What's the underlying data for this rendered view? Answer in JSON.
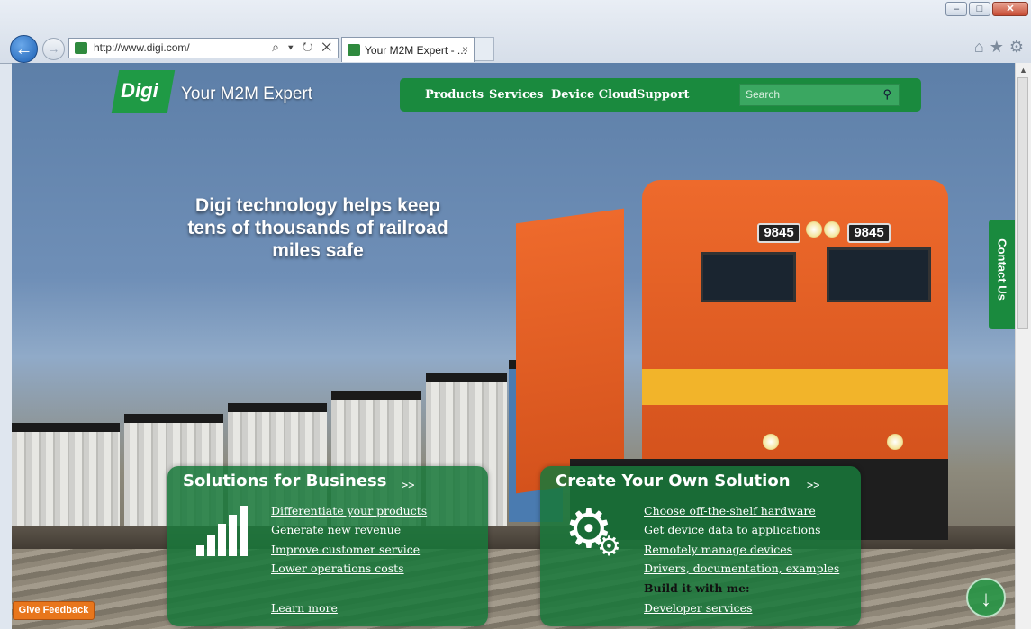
{
  "browser": {
    "address_url": "http://www.digi.com/",
    "address_actions": "⌕ ▾ ↻ ✕",
    "tab_title": "Your M2M Expert - ...",
    "tab_close": "×",
    "back_glyph": "←",
    "forward_glyph": "→",
    "window_buttons": {
      "minimize": "–",
      "maximize": "□",
      "close": "✕"
    },
    "toolbar_icons": {
      "home": "⌂",
      "favorites": "★",
      "tools": "⚙"
    }
  },
  "site": {
    "logo_text": "Digi",
    "tagline": "Your M2M Expert",
    "nav": [
      "Products",
      "Services",
      "Device Cloud",
      "Support"
    ],
    "search_placeholder": "Search",
    "search_icon": "⚲",
    "headline": "Digi technology helps keep tens of thousands of railroad miles safe",
    "contact_tab": "Contact Us",
    "locomotive_number": "9845",
    "give_feedback": "Give Feedback",
    "scroll_down_glyph": "↓"
  },
  "cards": {
    "business": {
      "title": "Solutions for Business",
      "arrow": ">>",
      "links": [
        "Differentiate your products",
        "Generate new revenue",
        "Improve customer service",
        "Lower operations costs"
      ],
      "learn_more": "Learn more"
    },
    "own": {
      "title": "Create Your Own Solution",
      "arrow": ">>",
      "links": [
        "Choose off-the-shelf hardware",
        "Get device data to applications",
        "Remotely manage devices",
        "Drivers, documentation, examples"
      ],
      "build_label": "Build it with me:",
      "developer_link": "Developer services"
    }
  },
  "colors": {
    "brand_green": "#1a8a3e",
    "feedback_orange": "#e8761c",
    "loco_orange": "#ee6a2c"
  }
}
